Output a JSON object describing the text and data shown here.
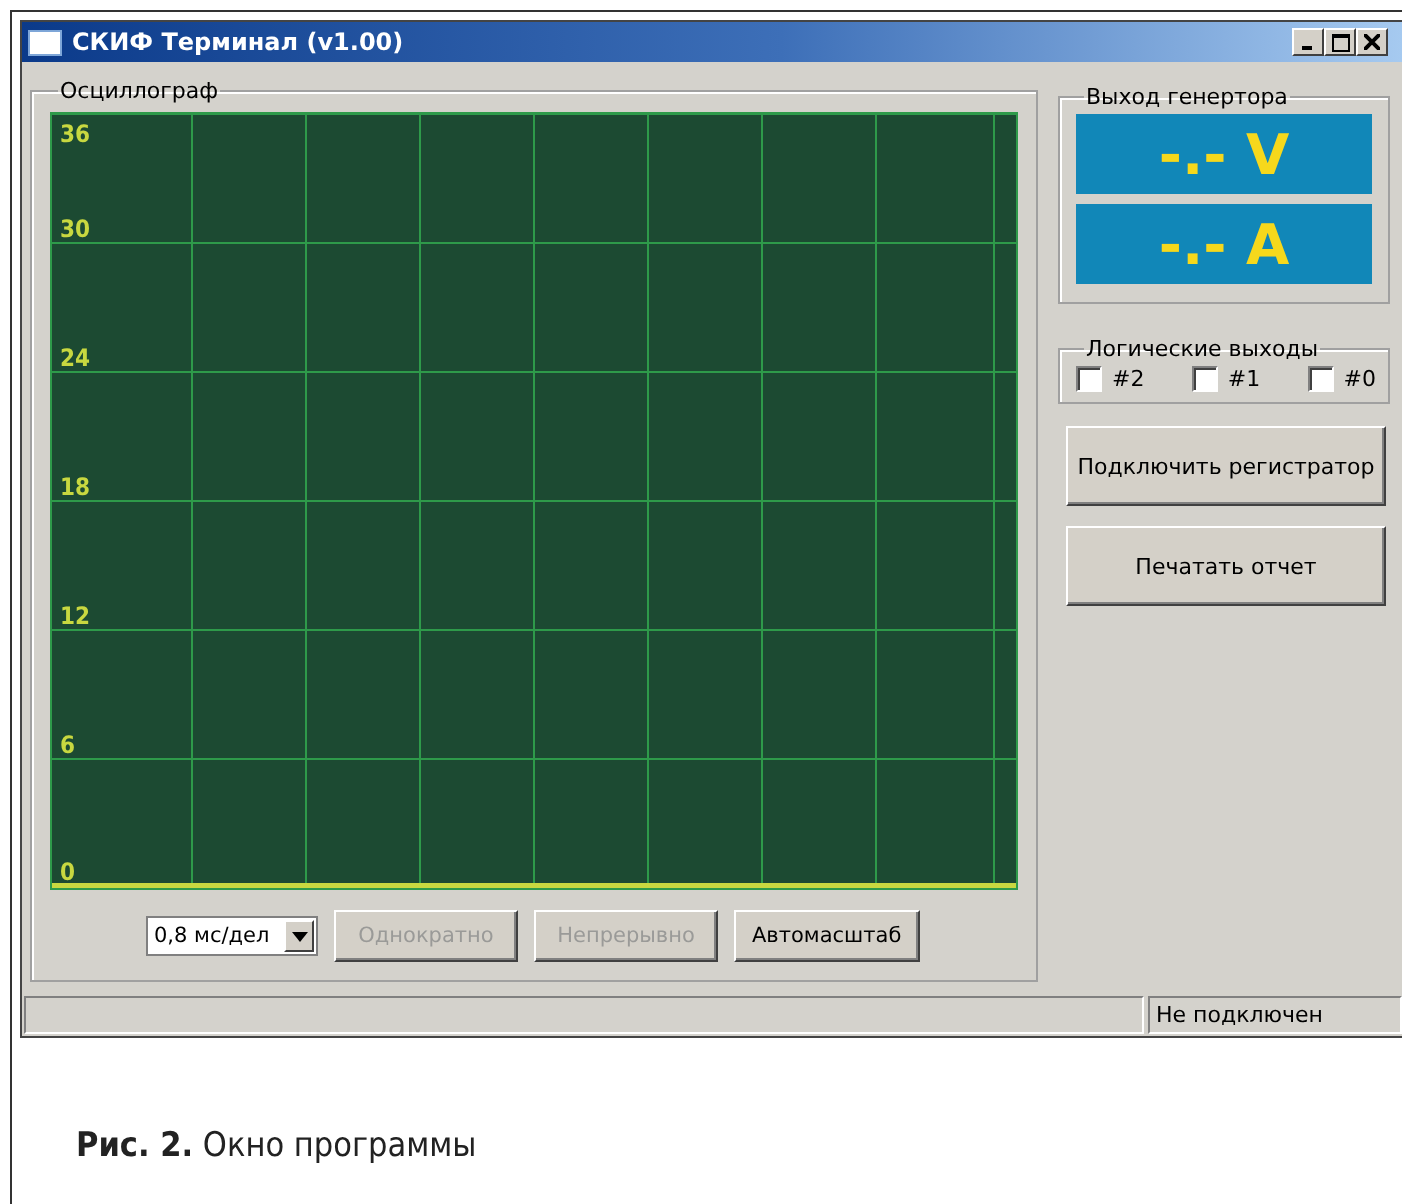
{
  "window": {
    "title": "СКИФ Терминал (v1.00)"
  },
  "oscilloscope": {
    "title": "Осциллограф",
    "y_labels": [
      "36",
      "30",
      "24",
      "18",
      "12",
      "6",
      "0"
    ],
    "timebase": {
      "value": "0,8 мс/дел"
    },
    "buttons": [
      {
        "label": "Однократно",
        "disabled": true
      },
      {
        "label": "Непрерывно",
        "disabled": true
      },
      {
        "label": "Автомасштаб",
        "disabled": false
      }
    ]
  },
  "generator_output": {
    "title": "Выход генертора",
    "readings": [
      "-.- V",
      "-.- A"
    ]
  },
  "logic_outputs": {
    "title": "Логические выходы",
    "items": [
      {
        "label": "#2",
        "checked": false
      },
      {
        "label": "#1",
        "checked": false
      },
      {
        "label": "#0",
        "checked": false
      }
    ]
  },
  "actions": [
    "Подключить регистратор",
    "Печатать отчет"
  ],
  "status_bar": {
    "connection": "Не подключен"
  },
  "caption": "**Рис. 2.** Окно программы"
}
